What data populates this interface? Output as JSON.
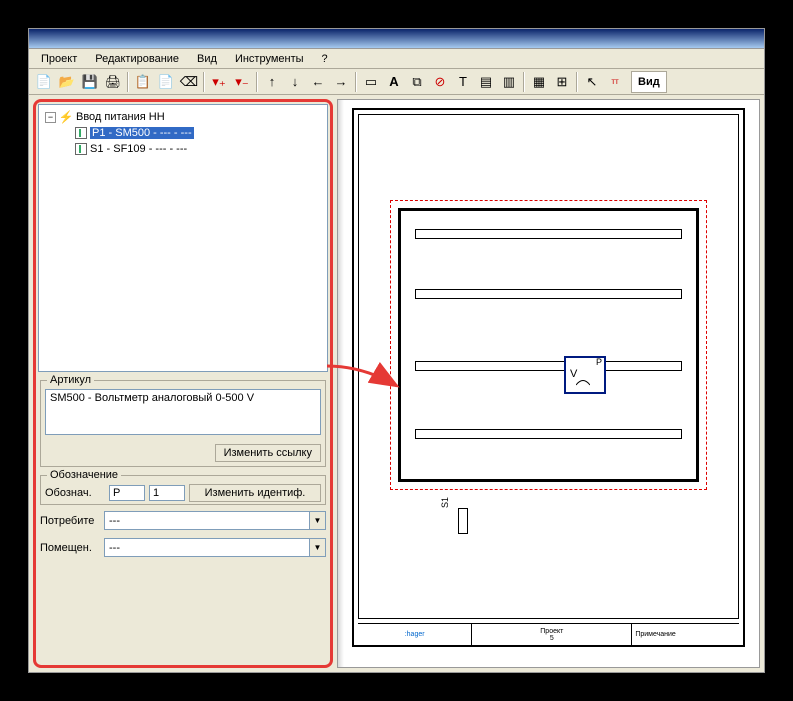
{
  "menu": {
    "project": "Проект",
    "edit": "Редактирование",
    "view": "Вид",
    "tools": "Инструменты",
    "help": "?"
  },
  "toolbar": {
    "view_btn": "Вид"
  },
  "tree": {
    "root": "Ввод питания НН",
    "item1": "P1 - SM500 - --- - ---",
    "item2": "S1 - SF109 - --- - ---"
  },
  "article": {
    "legend": "Артикул",
    "text": "SM500 - Вольтметр аналоговый 0-500 V",
    "change_link": "Изменить ссылку"
  },
  "designation": {
    "legend": "Обозначение",
    "label": "Обознач.",
    "prefix": "P",
    "number": "1",
    "change_id": "Изменить идентиф."
  },
  "consumer": {
    "label": "Потребите",
    "value": "---"
  },
  "room": {
    "label": "Помещен.",
    "value": "---"
  },
  "canvas": {
    "p_label": "P",
    "v_label": "V",
    "s1_label": "S1",
    "brand": ":hager",
    "project_word": "Проект",
    "page": "5",
    "note": "Примечание"
  }
}
